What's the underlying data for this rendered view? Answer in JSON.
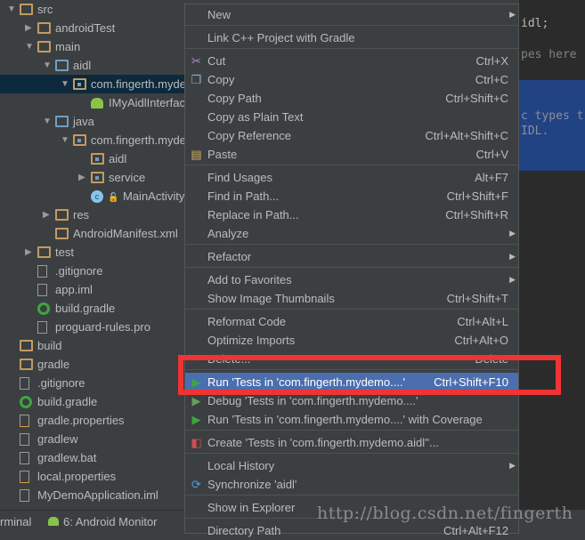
{
  "colors": {
    "tree_bg": "#3c3f41",
    "selection": "#0d293e",
    "menu_highlight": "#4b6eaf",
    "editor_bg": "#2b2b2b",
    "editor_selection": "#214283",
    "annotation_box": "#f03333"
  },
  "project_tree": [
    {
      "label": "src",
      "depth": 0,
      "arrow": "down",
      "icon": "folder-icon"
    },
    {
      "label": "androidTest",
      "depth": 1,
      "arrow": "right",
      "icon": "folder-icon"
    },
    {
      "label": "main",
      "depth": 1,
      "arrow": "down",
      "icon": "folder-icon"
    },
    {
      "label": "aidl",
      "depth": 2,
      "arrow": "down",
      "icon": "source-folder-icon"
    },
    {
      "label": "com.fingerth.mydemo",
      "depth": 3,
      "arrow": "down",
      "icon": "package-icon",
      "selected": true
    },
    {
      "label": "IMyAidlInterface",
      "depth": 4,
      "icon": "android-icon"
    },
    {
      "label": "java",
      "depth": 2,
      "arrow": "down",
      "icon": "source-folder-icon"
    },
    {
      "label": "com.fingerth.mydemo",
      "depth": 3,
      "arrow": "down",
      "icon": "package-icon"
    },
    {
      "label": "aidl",
      "depth": 4,
      "icon": "package-icon"
    },
    {
      "label": "service",
      "depth": 4,
      "arrow": "right",
      "icon": "package-icon"
    },
    {
      "label": "MainActivity",
      "depth": 4,
      "icon": "class-icon"
    },
    {
      "label": "res",
      "depth": 2,
      "arrow": "right",
      "icon": "resources-folder-icon"
    },
    {
      "label": "AndroidManifest.xml",
      "depth": 2,
      "icon": "manifest-icon"
    },
    {
      "label": "test",
      "depth": 1,
      "arrow": "right",
      "icon": "folder-icon"
    },
    {
      "label": ".gitignore",
      "depth": 1,
      "icon": "text-file-icon"
    },
    {
      "label": "app.iml",
      "depth": 1,
      "icon": "iml-file-icon"
    },
    {
      "label": "build.gradle",
      "depth": 1,
      "icon": "gradle-icon"
    },
    {
      "label": "proguard-rules.pro",
      "depth": 1,
      "icon": "text-file-icon"
    },
    {
      "label": "build",
      "depth": 0,
      "icon": "folder-icon"
    },
    {
      "label": "gradle",
      "depth": 0,
      "icon": "folder-icon"
    },
    {
      "label": ".gitignore",
      "depth": 0,
      "icon": "text-file-icon"
    },
    {
      "label": "build.gradle",
      "depth": 0,
      "icon": "gradle-icon"
    },
    {
      "label": "gradle.properties",
      "depth": 0,
      "icon": "properties-file-icon"
    },
    {
      "label": "gradlew",
      "depth": 0,
      "icon": "text-file-icon"
    },
    {
      "label": "gradlew.bat",
      "depth": 0,
      "icon": "text-file-icon"
    },
    {
      "label": "local.properties",
      "depth": 0,
      "icon": "properties-file-icon"
    },
    {
      "label": "MyDemoApplication.iml",
      "depth": 0,
      "icon": "iml-file-icon"
    }
  ],
  "bottom_bar": {
    "terminal": "rminal",
    "android_monitor": "6: Android Monitor"
  },
  "editor": {
    "lines": [
      "idl;",
      "pes here",
      "c types t",
      "IDL."
    ]
  },
  "context_menu": [
    {
      "label": "New",
      "submenu": true
    },
    {
      "sep": true
    },
    {
      "label": "Link C++ Project with Gradle"
    },
    {
      "sep": true
    },
    {
      "label": "Cut",
      "shortcut": "Ctrl+X",
      "icon": "scissors-icon"
    },
    {
      "label": "Copy",
      "shortcut": "Ctrl+C",
      "icon": "copy-icon"
    },
    {
      "label": "Copy Path",
      "shortcut": "Ctrl+Shift+C"
    },
    {
      "label": "Copy as Plain Text"
    },
    {
      "label": "Copy Reference",
      "shortcut": "Ctrl+Alt+Shift+C"
    },
    {
      "label": "Paste",
      "shortcut": "Ctrl+V",
      "icon": "paste-icon"
    },
    {
      "sep": true
    },
    {
      "label": "Find Usages",
      "shortcut": "Alt+F7"
    },
    {
      "label": "Find in Path...",
      "shortcut": "Ctrl+Shift+F"
    },
    {
      "label": "Replace in Path...",
      "shortcut": "Ctrl+Shift+R"
    },
    {
      "label": "Analyze",
      "submenu": true
    },
    {
      "sep": true
    },
    {
      "label": "Refactor",
      "submenu": true
    },
    {
      "sep": true
    },
    {
      "label": "Add to Favorites",
      "submenu": true
    },
    {
      "label": "Show Image Thumbnails",
      "shortcut": "Ctrl+Shift+T"
    },
    {
      "sep": true
    },
    {
      "label": "Reformat Code",
      "shortcut": "Ctrl+Alt+L"
    },
    {
      "label": "Optimize Imports",
      "shortcut": "Ctrl+Alt+O"
    },
    {
      "label": "Delete...",
      "shortcut": "Delete"
    },
    {
      "sep": true
    },
    {
      "label": "Run 'Tests in 'com.fingerth.mydemo....'",
      "shortcut": "Ctrl+Shift+F10",
      "icon": "run-icon",
      "highlighted": true
    },
    {
      "label": "Debug 'Tests in 'com.fingerth.mydemo....'",
      "icon": "debug-icon"
    },
    {
      "label": "Run 'Tests in 'com.fingerth.mydemo....' with Coverage",
      "icon": "coverage-icon"
    },
    {
      "sep": true
    },
    {
      "label": "Create 'Tests in 'com.fingerth.mydemo.aidl''...",
      "icon": "create-config-icon"
    },
    {
      "sep": true
    },
    {
      "label": "Local History",
      "submenu": true
    },
    {
      "label": "Synchronize 'aidl'",
      "icon": "sync-icon"
    },
    {
      "sep": true
    },
    {
      "label": "Show in Explorer"
    },
    {
      "sep": true
    },
    {
      "label": "Directory Path",
      "shortcut": "Ctrl+Alt+F12"
    }
  ],
  "watermark": "http://blog.csdn.net/fingerth"
}
